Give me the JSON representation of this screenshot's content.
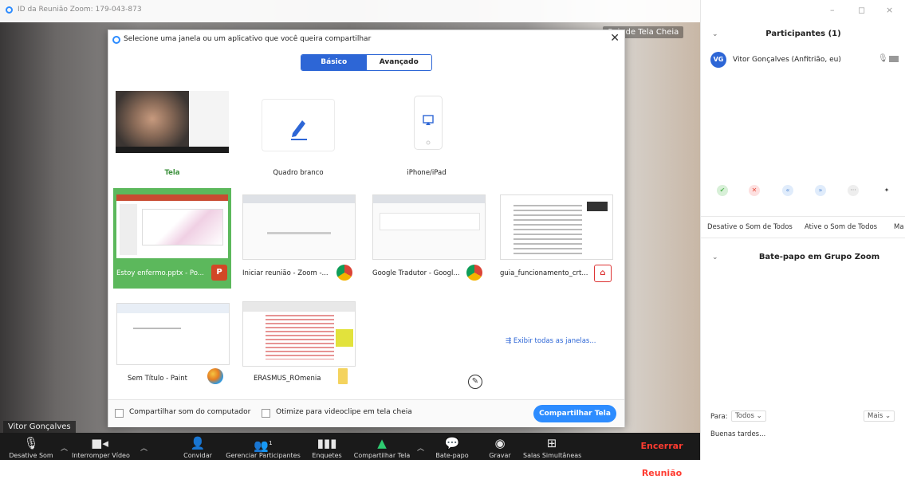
{
  "window": {
    "title": "ID da Reunião Zoom: 179-043-873",
    "fullscreen_label": "Sair de Tela Cheia",
    "minimize": "–",
    "restore": "◻",
    "close": "×"
  },
  "video": {
    "participant_name": "Vitor Gonçalves"
  },
  "dialog": {
    "title": "Selecione uma janela ou um aplicativo que você queira compartilhar",
    "tabs": [
      {
        "label": "Básico",
        "active": true
      },
      {
        "label": "Avançado",
        "active": false
      }
    ],
    "tiles": [
      {
        "label": "Tela",
        "selected": false
      },
      {
        "label": "Quadro branco"
      },
      {
        "label": "iPhone/iPad"
      },
      {
        "label": "Estoy enfermo.pptx - Po...",
        "selected": true,
        "app_icon": "P"
      },
      {
        "label": "Iniciar reunião - Zoom -..."
      },
      {
        "label": "Google Tradutor - Googl..."
      },
      {
        "label": "guia_funcionamento_crt..."
      },
      {
        "label": "Sem Título - Paint"
      },
      {
        "label": "ERASMUS_ROmenia"
      }
    ],
    "show_all_windows": "Exibir todas as janelas...",
    "share_computer_sound": "Compartilhar som do computador",
    "optimize_video": "Otimize para videoclipe em tela cheia",
    "share_button": "Compartilhar Tela"
  },
  "toolbar": {
    "mute": "Desative Som",
    "stop_video": "Interromper Vídeo",
    "invite": "Convidar",
    "manage_participants": "Gerenciar Participantes",
    "participant_count": "1",
    "polls": "Enquetes",
    "share_screen": "Compartilhar Tela",
    "chat": "Bate-papo",
    "record": "Gravar",
    "breakout": "Salas Simultâneas",
    "end": "Encerrar Reunião"
  },
  "panel": {
    "participants_title": "Participantes (1)",
    "avatar_initials": "VG",
    "participant_name": "Vitor Gonçalves (Anfitrião, eu)",
    "mute_all": "Desative o Som de Todos",
    "unmute_all": "Ative o Som de Todos",
    "more_short": "Ma",
    "chat_title": "Bate-papo em Grupo Zoom",
    "to_label": "Para:",
    "to_value": "Todos",
    "more": "Mais",
    "chat_text": "Buenas tardes..."
  },
  "colors": {
    "accent": "#2d8cff",
    "selected_tile": "#5cb85c",
    "end_button": "#ff3b30"
  }
}
